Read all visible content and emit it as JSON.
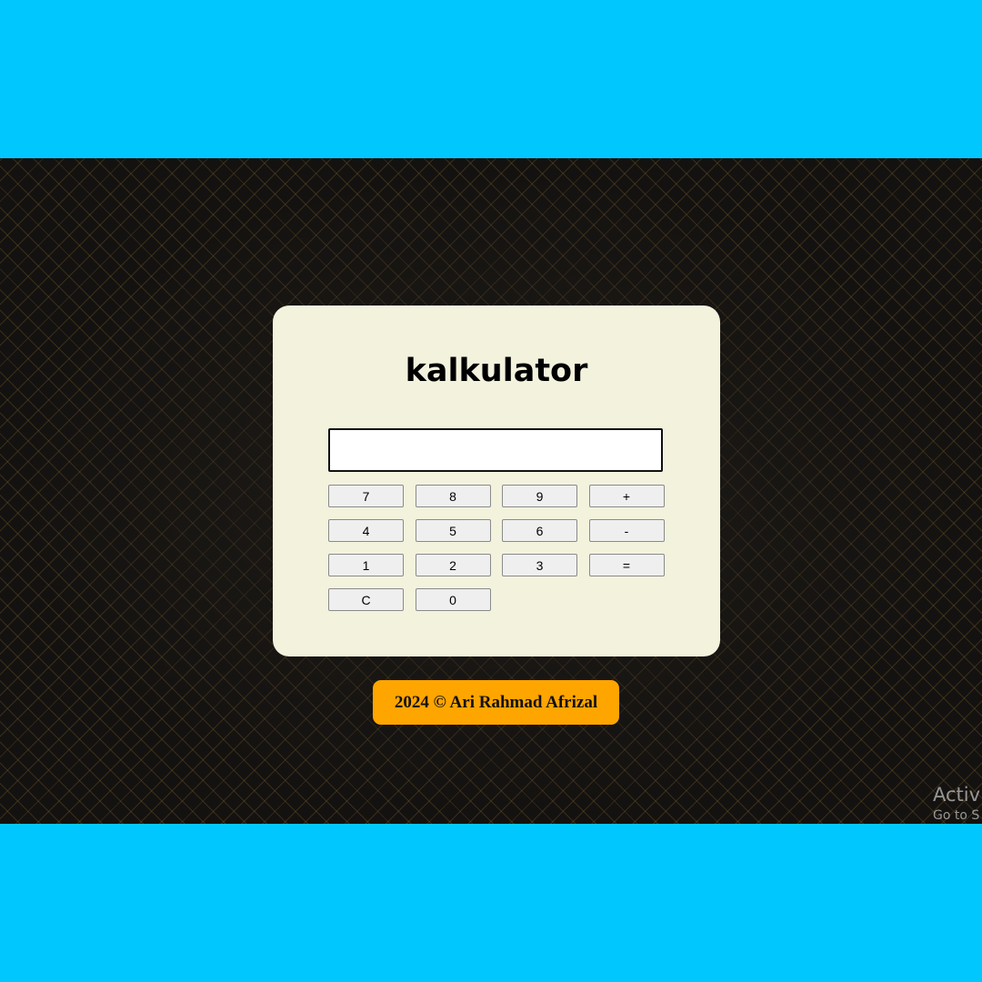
{
  "app": {
    "title": "kalkulator"
  },
  "display": {
    "value": ""
  },
  "keypad": {
    "keys": [
      "7",
      "8",
      "9",
      "+",
      "4",
      "5",
      "6",
      "-",
      "1",
      "2",
      "3",
      "=",
      "C",
      "0"
    ]
  },
  "footer": {
    "text": "2024 © Ari Rahmad Afrizal"
  },
  "watermark": {
    "line1": "Activ",
    "line2": "Go to S"
  },
  "colors": {
    "frame": "#00c8ff",
    "card": "#f3f2dd",
    "footer": "#ffa500",
    "page_background": "#141210"
  }
}
